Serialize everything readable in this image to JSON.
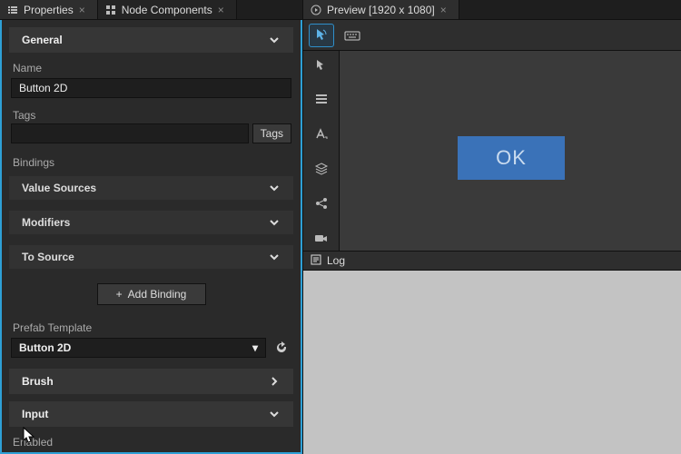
{
  "left": {
    "tabs": [
      {
        "label": "Properties",
        "active": true
      },
      {
        "label": "Node Components",
        "active": false
      }
    ],
    "general": {
      "title": "General"
    },
    "name": {
      "label": "Name",
      "value": "Button 2D"
    },
    "tags": {
      "label": "Tags",
      "value": "",
      "button": "Tags"
    },
    "bindings": {
      "label": "Bindings",
      "valueSources": "Value Sources",
      "modifiers": "Modifiers",
      "toSource": "To Source",
      "addBinding": "Add Binding"
    },
    "prefab": {
      "label": "Prefab Template",
      "value": "Button 2D"
    },
    "brush": {
      "title": "Brush"
    },
    "input": {
      "title": "Input",
      "enabledLabel": "Enabled"
    }
  },
  "right": {
    "previewTab": "Preview [1920 x 1080]",
    "canvas": {
      "buttonLabel": "OK"
    },
    "log": {
      "title": "Log"
    }
  }
}
